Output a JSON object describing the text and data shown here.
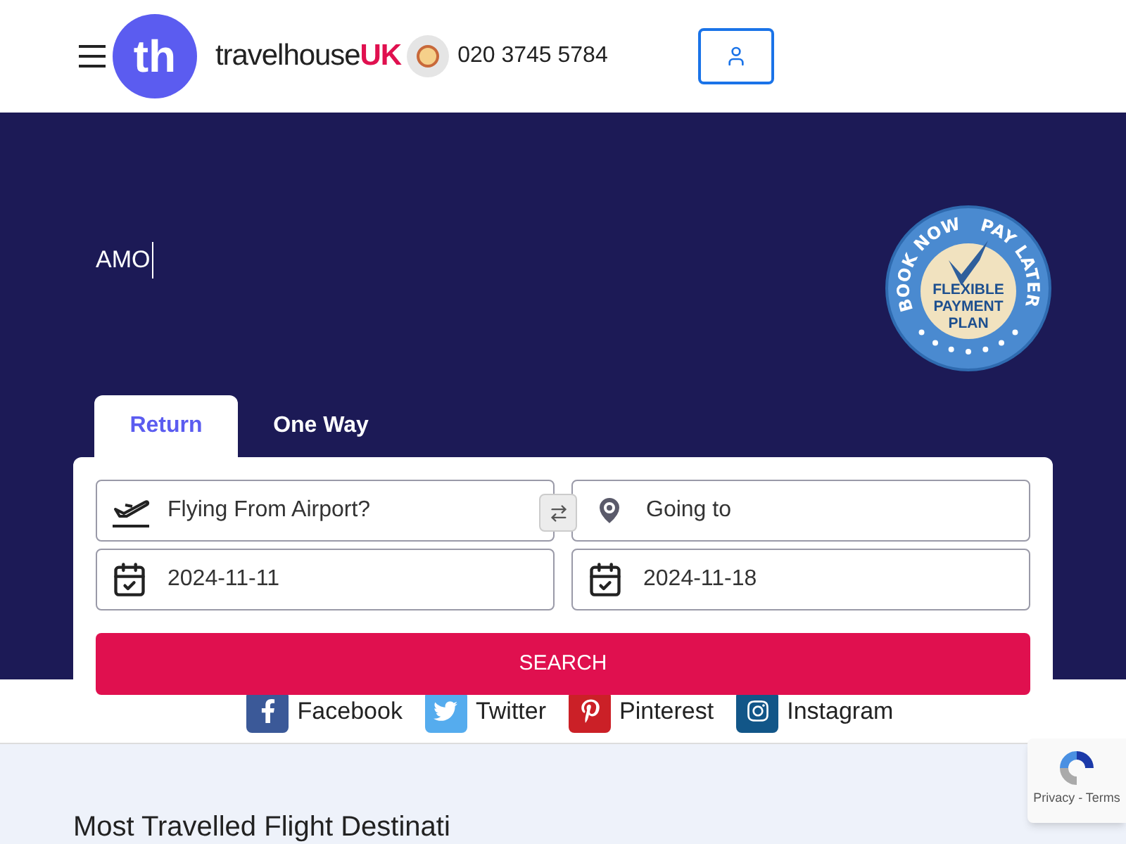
{
  "header": {
    "brand": "travelhouse",
    "brand_suffix": "UK",
    "logo_text": "th",
    "phone": "020 3745 5784"
  },
  "hero": {
    "typed_text": "AMO",
    "badge": {
      "top_left": "BOOK NOW",
      "top_right": "PAY LATER",
      "lines": [
        "FLEXIBLE",
        "PAYMENT",
        "PLAN"
      ]
    }
  },
  "tabs": [
    {
      "label": "Return",
      "selected": true
    },
    {
      "label": "One Way",
      "selected": false
    }
  ],
  "form": {
    "from_placeholder": "Flying From Airport?",
    "to_placeholder": "Going to",
    "depart_date": "2024-11-11",
    "return_date": "2024-11-18",
    "search_button": "SEARCH"
  },
  "social": [
    {
      "kind": "facebook",
      "label": "Facebook",
      "color": "#3b5998"
    },
    {
      "kind": "twitter",
      "label": "Twitter",
      "color": "#55acee"
    },
    {
      "kind": "pinterest",
      "label": "Pinterest",
      "color": "#cb2027"
    },
    {
      "kind": "instagram",
      "label": "Instagram",
      "color": "#125688"
    }
  ],
  "section_heading": "Most Travelled Flight Destinati",
  "recaptcha": {
    "links": "Privacy - Terms"
  }
}
